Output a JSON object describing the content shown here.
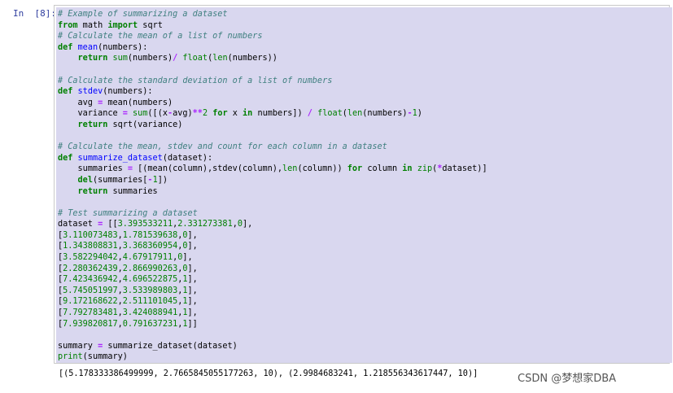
{
  "cell": {
    "prompt": "In  [8]:",
    "output": "[(5.178333386499999, 2.7665845055177263, 10), (2.9984683241, 1.218556343617447, 10)]"
  },
  "code_lines": [
    [
      [
        "cm",
        "# Example of summarizing a dataset"
      ]
    ],
    [
      [
        "kw",
        "from"
      ],
      [
        "",
        " math "
      ],
      [
        "kw",
        "import"
      ],
      [
        "",
        " sqrt"
      ]
    ],
    [
      [
        "cm",
        "# Calculate the mean of a list of numbers"
      ]
    ],
    [
      [
        "kw",
        "def"
      ],
      [
        "",
        " "
      ],
      [
        "fn",
        "mean"
      ],
      [
        "",
        "(numbers):"
      ]
    ],
    [
      [
        "",
        "    "
      ],
      [
        "kw",
        "return"
      ],
      [
        "",
        " "
      ],
      [
        "bi",
        "sum"
      ],
      [
        "",
        "(numbers)"
      ],
      [
        "op",
        "/"
      ],
      [
        "",
        " "
      ],
      [
        "bi",
        "float"
      ],
      [
        "",
        "("
      ],
      [
        "bi",
        "len"
      ],
      [
        "",
        "(numbers))"
      ]
    ],
    [
      [
        "",
        ""
      ]
    ],
    [
      [
        "cm",
        "# Calculate the standard deviation of a list of numbers"
      ]
    ],
    [
      [
        "kw",
        "def"
      ],
      [
        "",
        " "
      ],
      [
        "fn",
        "stdev"
      ],
      [
        "",
        "(numbers):"
      ]
    ],
    [
      [
        "",
        "    avg "
      ],
      [
        "op",
        "="
      ],
      [
        "",
        " mean(numbers)"
      ]
    ],
    [
      [
        "",
        "    variance "
      ],
      [
        "op",
        "="
      ],
      [
        "",
        " "
      ],
      [
        "bi",
        "sum"
      ],
      [
        "",
        "([(x"
      ],
      [
        "op",
        "-"
      ],
      [
        "",
        "avg)"
      ],
      [
        "op",
        "**"
      ],
      [
        "nm",
        "2"
      ],
      [
        "",
        " "
      ],
      [
        "kw",
        "for"
      ],
      [
        "",
        " x "
      ],
      [
        "kw",
        "in"
      ],
      [
        "",
        " numbers]) "
      ],
      [
        "op",
        "/"
      ],
      [
        "",
        " "
      ],
      [
        "bi",
        "float"
      ],
      [
        "",
        "("
      ],
      [
        "bi",
        "len"
      ],
      [
        "",
        "(numbers)"
      ],
      [
        "op",
        "-"
      ],
      [
        "nm",
        "1"
      ],
      [
        "",
        ")"
      ]
    ],
    [
      [
        "",
        "    "
      ],
      [
        "kw",
        "return"
      ],
      [
        "",
        " sqrt(variance)"
      ]
    ],
    [
      [
        "",
        ""
      ]
    ],
    [
      [
        "cm",
        "# Calculate the mean, stdev and count for each column in a dataset"
      ]
    ],
    [
      [
        "kw",
        "def"
      ],
      [
        "",
        " "
      ],
      [
        "fn",
        "summarize_dataset"
      ],
      [
        "",
        "(dataset):"
      ]
    ],
    [
      [
        "",
        "    summaries "
      ],
      [
        "op",
        "="
      ],
      [
        "",
        " [(mean(column),stdev(column),"
      ],
      [
        "bi",
        "len"
      ],
      [
        "",
        "(column)) "
      ],
      [
        "kw",
        "for"
      ],
      [
        "",
        " column "
      ],
      [
        "kw",
        "in"
      ],
      [
        "",
        " "
      ],
      [
        "bi",
        "zip"
      ],
      [
        "",
        "("
      ],
      [
        "op",
        "*"
      ],
      [
        "",
        "dataset)]"
      ]
    ],
    [
      [
        "",
        "    "
      ],
      [
        "kw",
        "del"
      ],
      [
        "",
        "(summaries["
      ],
      [
        "op",
        "-"
      ],
      [
        "nm",
        "1"
      ],
      [
        "",
        "])"
      ]
    ],
    [
      [
        "",
        "    "
      ],
      [
        "kw",
        "return"
      ],
      [
        "",
        " summaries"
      ]
    ],
    [
      [
        "",
        ""
      ]
    ],
    [
      [
        "cm",
        "# Test summarizing a dataset"
      ]
    ],
    [
      [
        "",
        "dataset "
      ],
      [
        "op",
        "="
      ],
      [
        "",
        " [["
      ],
      [
        "nm",
        "3.393533211"
      ],
      [
        "",
        ","
      ],
      [
        "nm",
        "2.331273381"
      ],
      [
        "",
        ","
      ],
      [
        "nm",
        "0"
      ],
      [
        "",
        "],"
      ]
    ],
    [
      [
        "",
        "["
      ],
      [
        "nm",
        "3.110073483"
      ],
      [
        "",
        ","
      ],
      [
        "nm",
        "1.781539638"
      ],
      [
        "",
        ","
      ],
      [
        "nm",
        "0"
      ],
      [
        "",
        "],"
      ]
    ],
    [
      [
        "",
        "["
      ],
      [
        "nm",
        "1.343808831"
      ],
      [
        "",
        ","
      ],
      [
        "nm",
        "3.368360954"
      ],
      [
        "",
        ","
      ],
      [
        "nm",
        "0"
      ],
      [
        "",
        "],"
      ]
    ],
    [
      [
        "",
        "["
      ],
      [
        "nm",
        "3.582294042"
      ],
      [
        "",
        ","
      ],
      [
        "nm",
        "4.67917911"
      ],
      [
        "",
        ","
      ],
      [
        "nm",
        "0"
      ],
      [
        "",
        "],"
      ]
    ],
    [
      [
        "",
        "["
      ],
      [
        "nm",
        "2.280362439"
      ],
      [
        "",
        ","
      ],
      [
        "nm",
        "2.866990263"
      ],
      [
        "",
        ","
      ],
      [
        "nm",
        "0"
      ],
      [
        "",
        "],"
      ]
    ],
    [
      [
        "",
        "["
      ],
      [
        "nm",
        "7.423436942"
      ],
      [
        "",
        ","
      ],
      [
        "nm",
        "4.696522875"
      ],
      [
        "",
        ","
      ],
      [
        "nm",
        "1"
      ],
      [
        "",
        "],"
      ]
    ],
    [
      [
        "",
        "["
      ],
      [
        "nm",
        "5.745051997"
      ],
      [
        "",
        ","
      ],
      [
        "nm",
        "3.533989803"
      ],
      [
        "",
        ","
      ],
      [
        "nm",
        "1"
      ],
      [
        "",
        "],"
      ]
    ],
    [
      [
        "",
        "["
      ],
      [
        "nm",
        "9.172168622"
      ],
      [
        "",
        ","
      ],
      [
        "nm",
        "2.511101045"
      ],
      [
        "",
        ","
      ],
      [
        "nm",
        "1"
      ],
      [
        "",
        "],"
      ]
    ],
    [
      [
        "",
        "["
      ],
      [
        "nm",
        "7.792783481"
      ],
      [
        "",
        ","
      ],
      [
        "nm",
        "3.424088941"
      ],
      [
        "",
        ","
      ],
      [
        "nm",
        "1"
      ],
      [
        "",
        "],"
      ]
    ],
    [
      [
        "",
        "["
      ],
      [
        "nm",
        "7.939820817"
      ],
      [
        "",
        ","
      ],
      [
        "nm",
        "0.791637231"
      ],
      [
        "",
        ","
      ],
      [
        "nm",
        "1"
      ],
      [
        "",
        "]]"
      ]
    ],
    [
      [
        "",
        ""
      ]
    ],
    [
      [
        "",
        "summary "
      ],
      [
        "op",
        "="
      ],
      [
        "",
        " summarize_dataset(dataset)"
      ]
    ],
    [
      [
        "bi",
        "print"
      ],
      [
        "",
        "(summary)"
      ]
    ]
  ],
  "watermark": "CSDN @梦想家DBA"
}
